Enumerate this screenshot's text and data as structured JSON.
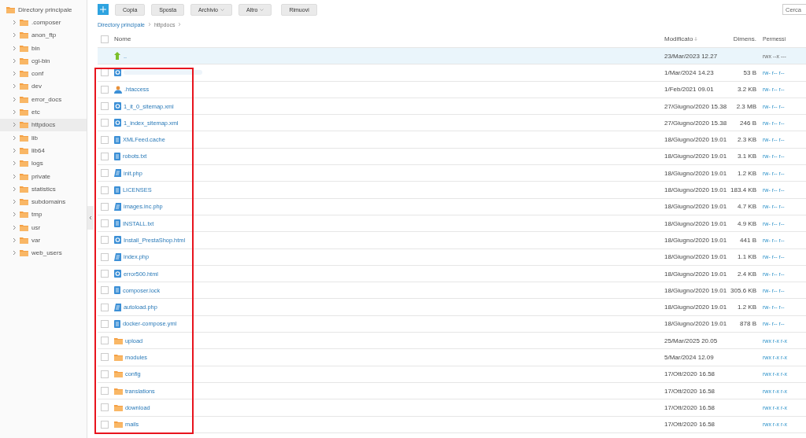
{
  "sidebar": {
    "tree": [
      {
        "label": "Directory principale",
        "selected": false,
        "expanded": true,
        "children": [
          {
            "label": ".composer",
            "selected": false,
            "expanded": false
          },
          {
            "label": "anon_ftp",
            "selected": false,
            "expanded": false
          },
          {
            "label": "bin",
            "selected": false,
            "expanded": false
          },
          {
            "label": "cgi-bin",
            "selected": false,
            "expanded": false
          },
          {
            "label": "conf",
            "selected": false,
            "expanded": false
          },
          {
            "label": "dev",
            "selected": false,
            "expanded": false
          },
          {
            "label": "error_docs",
            "selected": false,
            "expanded": false
          },
          {
            "label": "etc",
            "selected": false,
            "expanded": false
          },
          {
            "label": "httpdocs",
            "selected": true,
            "expanded": false
          },
          {
            "label": "lib",
            "selected": false,
            "expanded": false
          },
          {
            "label": "lib64",
            "selected": false,
            "expanded": false
          },
          {
            "label": "logs",
            "selected": false,
            "expanded": false
          },
          {
            "label": "private",
            "selected": false,
            "expanded": false
          },
          {
            "label": "statistics",
            "selected": false,
            "expanded": false
          },
          {
            "label": "subdomains",
            "selected": false,
            "expanded": false
          },
          {
            "label": "tmp",
            "selected": false,
            "expanded": false
          },
          {
            "label": "usr",
            "selected": false,
            "expanded": false
          },
          {
            "label": "var",
            "selected": false,
            "expanded": false
          },
          {
            "label": "web_users",
            "selected": false,
            "expanded": false
          }
        ]
      }
    ]
  },
  "toolbar": {
    "buttons": [
      {
        "label": "Copia",
        "dropdown": false
      },
      {
        "label": "Sposta",
        "dropdown": false
      },
      {
        "label": "Archivio",
        "dropdown": true
      },
      {
        "label": "Altro",
        "dropdown": true
      },
      {
        "label": "Rimuovi",
        "dropdown": false
      }
    ],
    "search": {
      "placeholder": "Cerca"
    }
  },
  "breadcrumb": [
    {
      "label": "Directory principale",
      "link": true
    },
    {
      "label": "httpdocs",
      "link": false
    }
  ],
  "table": {
    "select_all_checked": false,
    "columns": [
      {
        "label": "Nome",
        "sorted": false
      },
      {
        "label": "Modificato",
        "sorted": true
      },
      {
        "label": "Dimens.",
        "sorted": false
      },
      {
        "label": "Permessi",
        "sorted": false
      }
    ],
    "rows": [
      {
        "kind": "parent",
        "name": "..",
        "redacted": false,
        "selected": true,
        "modified": "23/Mar/2023 12.27",
        "permissions": "rwx --x ---"
      },
      {
        "kind": "html",
        "redacted": true,
        "selected": false,
        "checked": false,
        "modified": "1/Mar/2024 14.23",
        "size": "53 B",
        "permissions": "rw- r-- r--"
      },
      {
        "kind": "user",
        "name": ".htaccess",
        "redacted": false,
        "selected": false,
        "checked": false,
        "modified": "1/Feb/2021 09.01",
        "size": "3.2 KB",
        "permissions": "rw- r-- r--"
      },
      {
        "kind": "html",
        "name": "1_it_0_sitemap.xml",
        "redacted": false,
        "selected": false,
        "checked": false,
        "modified": "27/Giugno/2020 15.38",
        "size": "2.3 MB",
        "permissions": "rw- r-- r--"
      },
      {
        "kind": "html",
        "name": "1_index_sitemap.xml",
        "redacted": false,
        "selected": false,
        "checked": false,
        "modified": "27/Giugno/2020 15.38",
        "size": "246 B",
        "permissions": "rw- r-- r--"
      },
      {
        "kind": "text",
        "name": "XMLFeed.cache",
        "redacted": false,
        "selected": false,
        "checked": false,
        "modified": "18/Giugno/2020 19.01",
        "size": "2.3 KB",
        "permissions": "rw- r-- r--"
      },
      {
        "kind": "text",
        "name": "robots.txt",
        "redacted": false,
        "selected": false,
        "checked": false,
        "modified": "18/Giugno/2020 19.01",
        "size": "3.1 KB",
        "permissions": "rw- r-- r--"
      },
      {
        "kind": "php",
        "name": "init.php",
        "redacted": false,
        "selected": false,
        "checked": false,
        "modified": "18/Giugno/2020 19.01",
        "size": "1.2 KB",
        "permissions": "rw- r-- r--"
      },
      {
        "kind": "text",
        "name": "LICENSES",
        "redacted": false,
        "selected": false,
        "checked": false,
        "modified": "18/Giugno/2020 19.01",
        "size": "183.4 KB",
        "permissions": "rw- r-- r--"
      },
      {
        "kind": "php",
        "name": "images.inc.php",
        "redacted": false,
        "selected": false,
        "checked": false,
        "modified": "18/Giugno/2020 19.01",
        "size": "4.7 KB",
        "permissions": "rw- r-- r--"
      },
      {
        "kind": "text",
        "name": "INSTALL.txt",
        "redacted": false,
        "selected": false,
        "checked": false,
        "modified": "18/Giugno/2020 19.01",
        "size": "4.9 KB",
        "permissions": "rw- r-- r--"
      },
      {
        "kind": "html",
        "name": "Install_PrestaShop.html",
        "redacted": false,
        "selected": false,
        "checked": false,
        "modified": "18/Giugno/2020 19.01",
        "size": "441 B",
        "permissions": "rw- r-- r--"
      },
      {
        "kind": "php",
        "name": "index.php",
        "redacted": false,
        "selected": false,
        "checked": false,
        "modified": "18/Giugno/2020 19.01",
        "size": "1.1 KB",
        "permissions": "rw- r-- r--"
      },
      {
        "kind": "html",
        "name": "error500.html",
        "redacted": false,
        "selected": false,
        "checked": false,
        "modified": "18/Giugno/2020 19.01",
        "size": "2.4 KB",
        "permissions": "rw- r-- r--"
      },
      {
        "kind": "text",
        "name": "composer.lock",
        "redacted": false,
        "selected": false,
        "checked": false,
        "modified": "18/Giugno/2020 19.01",
        "size": "305.6 KB",
        "permissions": "rw- r-- r--"
      },
      {
        "kind": "php",
        "name": "autoload.php",
        "redacted": false,
        "selected": false,
        "checked": false,
        "modified": "18/Giugno/2020 19.01",
        "size": "1.2 KB",
        "permissions": "rw- r-- r--"
      },
      {
        "kind": "text",
        "name": "docker-compose.yml",
        "redacted": false,
        "selected": false,
        "checked": false,
        "modified": "18/Giugno/2020 19.01",
        "size": "878 B",
        "permissions": "rw- r-- r--"
      },
      {
        "kind": "folder",
        "name": "upload",
        "redacted": false,
        "selected": false,
        "checked": false,
        "modified": "25/Mar/2025 20.05",
        "permissions": "rwx r-x r-x"
      },
      {
        "kind": "folder",
        "name": "modules",
        "redacted": false,
        "selected": false,
        "checked": false,
        "modified": "5/Mar/2024 12.09",
        "permissions": "rwx r-x r-x"
      },
      {
        "kind": "folder",
        "name": "config",
        "redacted": false,
        "selected": false,
        "checked": false,
        "modified": "17/Ott/2020 16.58",
        "permissions": "rwx r-x r-x"
      },
      {
        "kind": "folder",
        "name": "translations",
        "redacted": false,
        "selected": false,
        "checked": false,
        "modified": "17/Ott/2020 16.58",
        "permissions": "rwx r-x r-x"
      },
      {
        "kind": "folder",
        "name": "download",
        "redacted": false,
        "selected": false,
        "checked": false,
        "modified": "17/Ott/2020 16.58",
        "permissions": "rwx r-x r-x"
      },
      {
        "kind": "folder",
        "name": "mails",
        "redacted": false,
        "selected": false,
        "checked": false,
        "modified": "17/Ott/2020 16.58",
        "permissions": "rwx r-x r-x"
      }
    ]
  },
  "annotation": {
    "kind": "highlight-frame",
    "color": "#e8141e"
  }
}
